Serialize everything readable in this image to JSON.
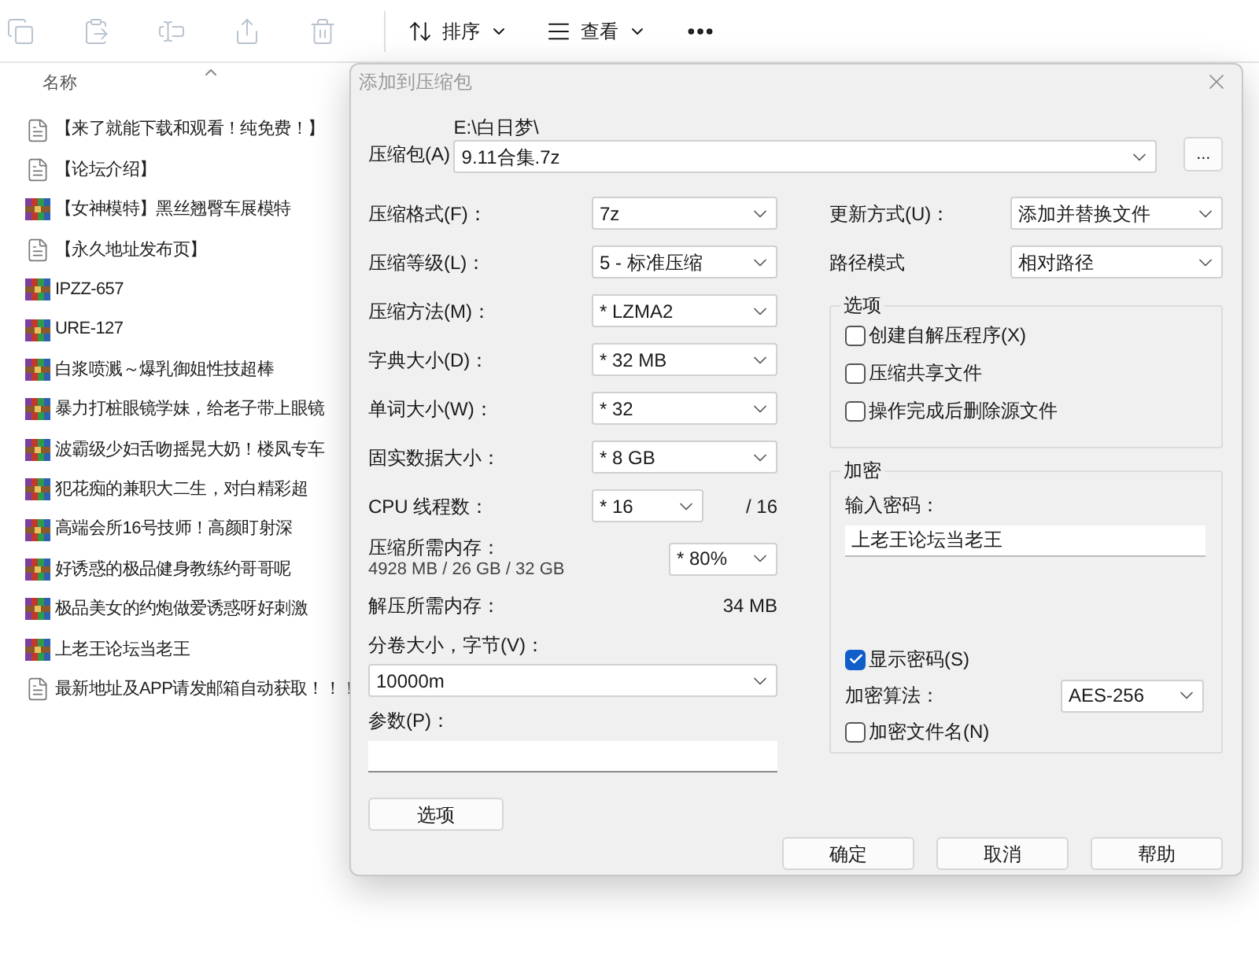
{
  "toolbar": {
    "sort_label": "排序",
    "view_label": "查看"
  },
  "file_list": {
    "column": "名称",
    "files": [
      {
        "name": "【来了就能下载和观看！纯免费！】",
        "kind": "document"
      },
      {
        "name": "【论坛介绍】",
        "kind": "document"
      },
      {
        "name": "【女神模特】黑丝翘臀车展模特",
        "kind": "archive"
      },
      {
        "name": "【永久地址发布页】",
        "kind": "document"
      },
      {
        "name": "IPZZ-657",
        "kind": "archive"
      },
      {
        "name": "URE-127",
        "kind": "archive"
      },
      {
        "name": "白浆喷溅～爆乳御姐性技超棒",
        "kind": "archive"
      },
      {
        "name": "暴力打桩眼镜学妹，给老子带上眼镜",
        "kind": "archive"
      },
      {
        "name": "波霸级少妇舌吻摇晃大奶！楼凤专车",
        "kind": "archive"
      },
      {
        "name": "犯花痴的兼职大二生，对白精彩超",
        "kind": "archive"
      },
      {
        "name": "高端会所16号技师！高颜盯射深",
        "kind": "archive"
      },
      {
        "name": "好诱惑的极品健身教练约哥哥呢",
        "kind": "archive"
      },
      {
        "name": "极品美女的约炮做爱诱惑呀好刺激",
        "kind": "archive"
      },
      {
        "name": "上老王论坛当老王",
        "kind": "archive"
      },
      {
        "name": "最新地址及APP请发邮箱自动获取！！！",
        "kind": "document"
      }
    ]
  },
  "dialog": {
    "title": "添加到压缩包",
    "archive": {
      "label": "压缩包(A)",
      "path": "E:\\白日梦\\",
      "value": "9.11合集.7z",
      "browse": "..."
    },
    "left_settings": [
      {
        "label": "压缩格式(F)：",
        "value": "7z"
      },
      {
        "label": "压缩等级(L)：",
        "value": "5 - 标准压缩"
      },
      {
        "label": "压缩方法(M)：",
        "value": "* LZMA2"
      },
      {
        "label": "字典大小(D)：",
        "value": "* 32 MB"
      },
      {
        "label": "单词大小(W)：",
        "value": "* 32"
      },
      {
        "label": "固实数据大小：",
        "value": "* 8 GB"
      }
    ],
    "threads": {
      "label": "CPU 线程数：",
      "value": "* 16",
      "max": "/ 16"
    },
    "memory": {
      "label": "压缩所需内存：",
      "detail": "4928 MB / 26 GB / 32 GB",
      "value": "* 80%"
    },
    "decompress_memory": {
      "label": "解压所需内存：",
      "value": "34 MB"
    },
    "volume": {
      "label": "分卷大小，字节(V)：",
      "value": "10000m"
    },
    "parameters": {
      "label": "参数(P)："
    },
    "options_button": "选项",
    "right_settings": [
      {
        "label": "更新方式(U)：",
        "value": "添加并替换文件"
      },
      {
        "label": "路径模式",
        "value": "相对路径"
      }
    ],
    "options_group": {
      "title": "选项",
      "checkboxes": [
        {
          "label": "创建自解压程序(X)",
          "checked": false
        },
        {
          "label": "压缩共享文件",
          "checked": false
        },
        {
          "label": "操作完成后删除源文件",
          "checked": false
        }
      ]
    },
    "encryption": {
      "title": "加密",
      "password_label": "输入密码：",
      "password": "上老王论坛当老王",
      "show_password": {
        "label": "显示密码(S)",
        "checked": true
      },
      "method_label": "加密算法：",
      "method": "AES-256",
      "encrypt_names": {
        "label": "加密文件名(N)",
        "checked": false
      }
    },
    "buttons": [
      "确定",
      "取消",
      "帮助"
    ]
  }
}
